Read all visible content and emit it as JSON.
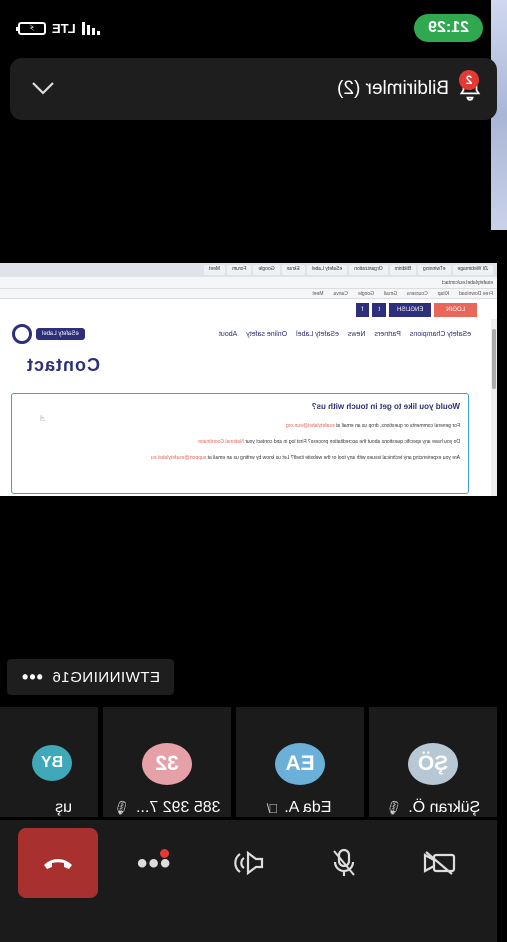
{
  "status": {
    "time": "21:29",
    "network": "LTE",
    "battery_glyph": "⚡"
  },
  "notification": {
    "title": "Bildirimler (2)",
    "badge": "2"
  },
  "shared_screen": {
    "tabs": [
      "Zil Webimage",
      "eTwinning",
      "Bildirim",
      "Organization",
      "eSafety Label",
      "Ekran",
      "Google",
      "Forum",
      "Meet"
    ],
    "url": "esafetylabel.eu/contact",
    "bookmarks": [
      "Free Download",
      "Kitap",
      "Coursera",
      "Gmail",
      "Google",
      "Canva",
      "Meet"
    ],
    "top_buttons": {
      "login": "LOGIN",
      "language": "ENGLISH",
      "facebook": "f",
      "twitter": "t"
    },
    "logo": "eSafety Label",
    "nav": [
      "About",
      "Online safety",
      "eSafety Label",
      "News",
      "Partners",
      "eSafety Champions"
    ],
    "page_title": "Contact",
    "box_heading": "Would you like to get in touch with us?",
    "lines": [
      {
        "text": "For general comments or questions, drop us an email at ",
        "link": "esafetylabel@eun.org"
      },
      {
        "text": "Do you have any specific questions about the accreditation process? First log in and contact your ",
        "link": "National Coordinator"
      },
      {
        "text": "Are you experiencing any technical issues with any tool or the website itself? Let us know by writing us an email at ",
        "link": "support@esafetylabel.eu"
      }
    ]
  },
  "presenter": {
    "name": "ETWINNING16",
    "more": "•••"
  },
  "participants": [
    {
      "initials": "ŞÖ",
      "name": "Şükran Ö.",
      "color": "#b7c7d3"
    },
    {
      "initials": "EA",
      "name": "Eda A.",
      "color": "#6ab0d8"
    },
    {
      "initials": "32",
      "name": "385 392 7...",
      "color": "#e6a0a8"
    },
    {
      "initials": "BY",
      "name": "uş",
      "color": "#3fa9b9"
    }
  ],
  "controls": {
    "video": "video-off",
    "mic": "mic",
    "speaker": "speaker",
    "more": "•••",
    "hangup": "end-call"
  }
}
